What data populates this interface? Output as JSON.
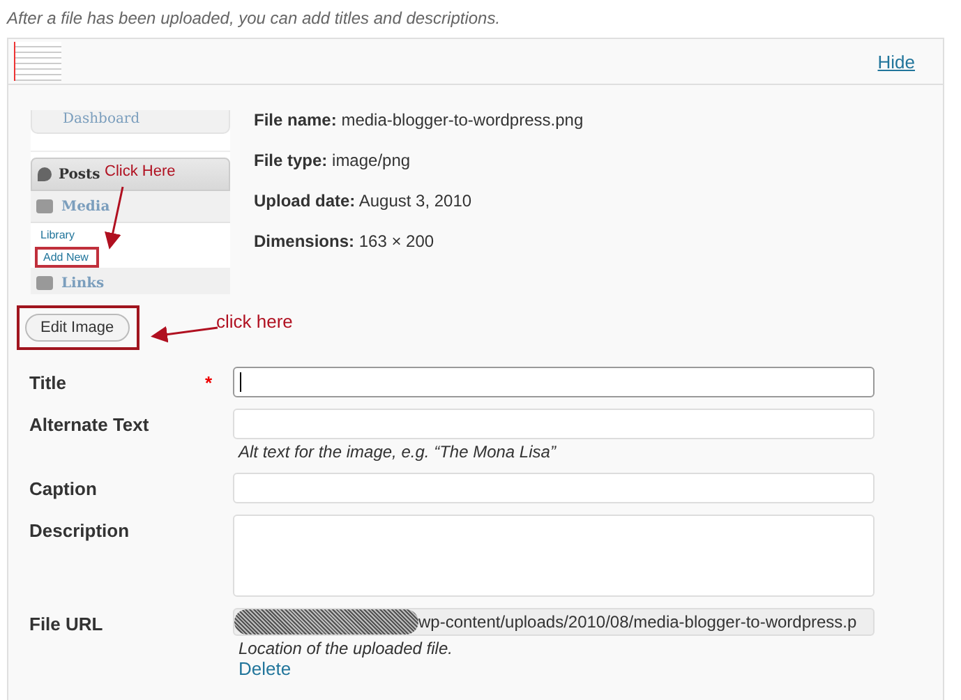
{
  "intro": "After a file has been uploaded, you can add titles and descriptions.",
  "header": {
    "hide_link": "Hide"
  },
  "screenshot": {
    "items": [
      {
        "kind": "cut",
        "label": "Dashboard",
        "highlighted": false
      },
      {
        "kind": "heading",
        "label": "Posts",
        "highlighted": false
      },
      {
        "kind": "group",
        "label": "Media",
        "highlighted": false
      },
      {
        "kind": "sub",
        "label": "Library",
        "highlighted": false
      },
      {
        "kind": "sub",
        "label": "Add New",
        "highlighted": true
      },
      {
        "kind": "group",
        "label": "Links",
        "highlighted": false
      }
    ]
  },
  "file_info": [
    {
      "label": "File name:",
      "value": "media-blogger-to-wordpress.png"
    },
    {
      "label": "File type:",
      "value": "image/png"
    },
    {
      "label": "Upload date:",
      "value": "August 3, 2010"
    },
    {
      "label": "Dimensions:",
      "value": "163 × 200"
    }
  ],
  "edit_button": "Edit Image",
  "annotations": [
    {
      "text": "Click Here"
    },
    {
      "text": "click here"
    }
  ],
  "required_mark": "*",
  "fields": [
    {
      "kind": "input",
      "label": "Title",
      "required": true,
      "focused": true
    },
    {
      "kind": "input",
      "label": "Alternate Text",
      "required": false,
      "focused": false,
      "hint": "Alt text for the image, e.g. “The Mona Lisa”"
    },
    {
      "kind": "input",
      "label": "Caption",
      "required": false,
      "focused": false
    },
    {
      "kind": "textarea",
      "label": "Description",
      "required": false,
      "focused": false
    },
    {
      "kind": "url",
      "label": "File URL",
      "required": false,
      "focused": false,
      "value": "wp-content/uploads/2010/08/media-blogger-to-wordpress.p",
      "hint": "Location of the uploaded file."
    }
  ],
  "delete_link": "Delete"
}
